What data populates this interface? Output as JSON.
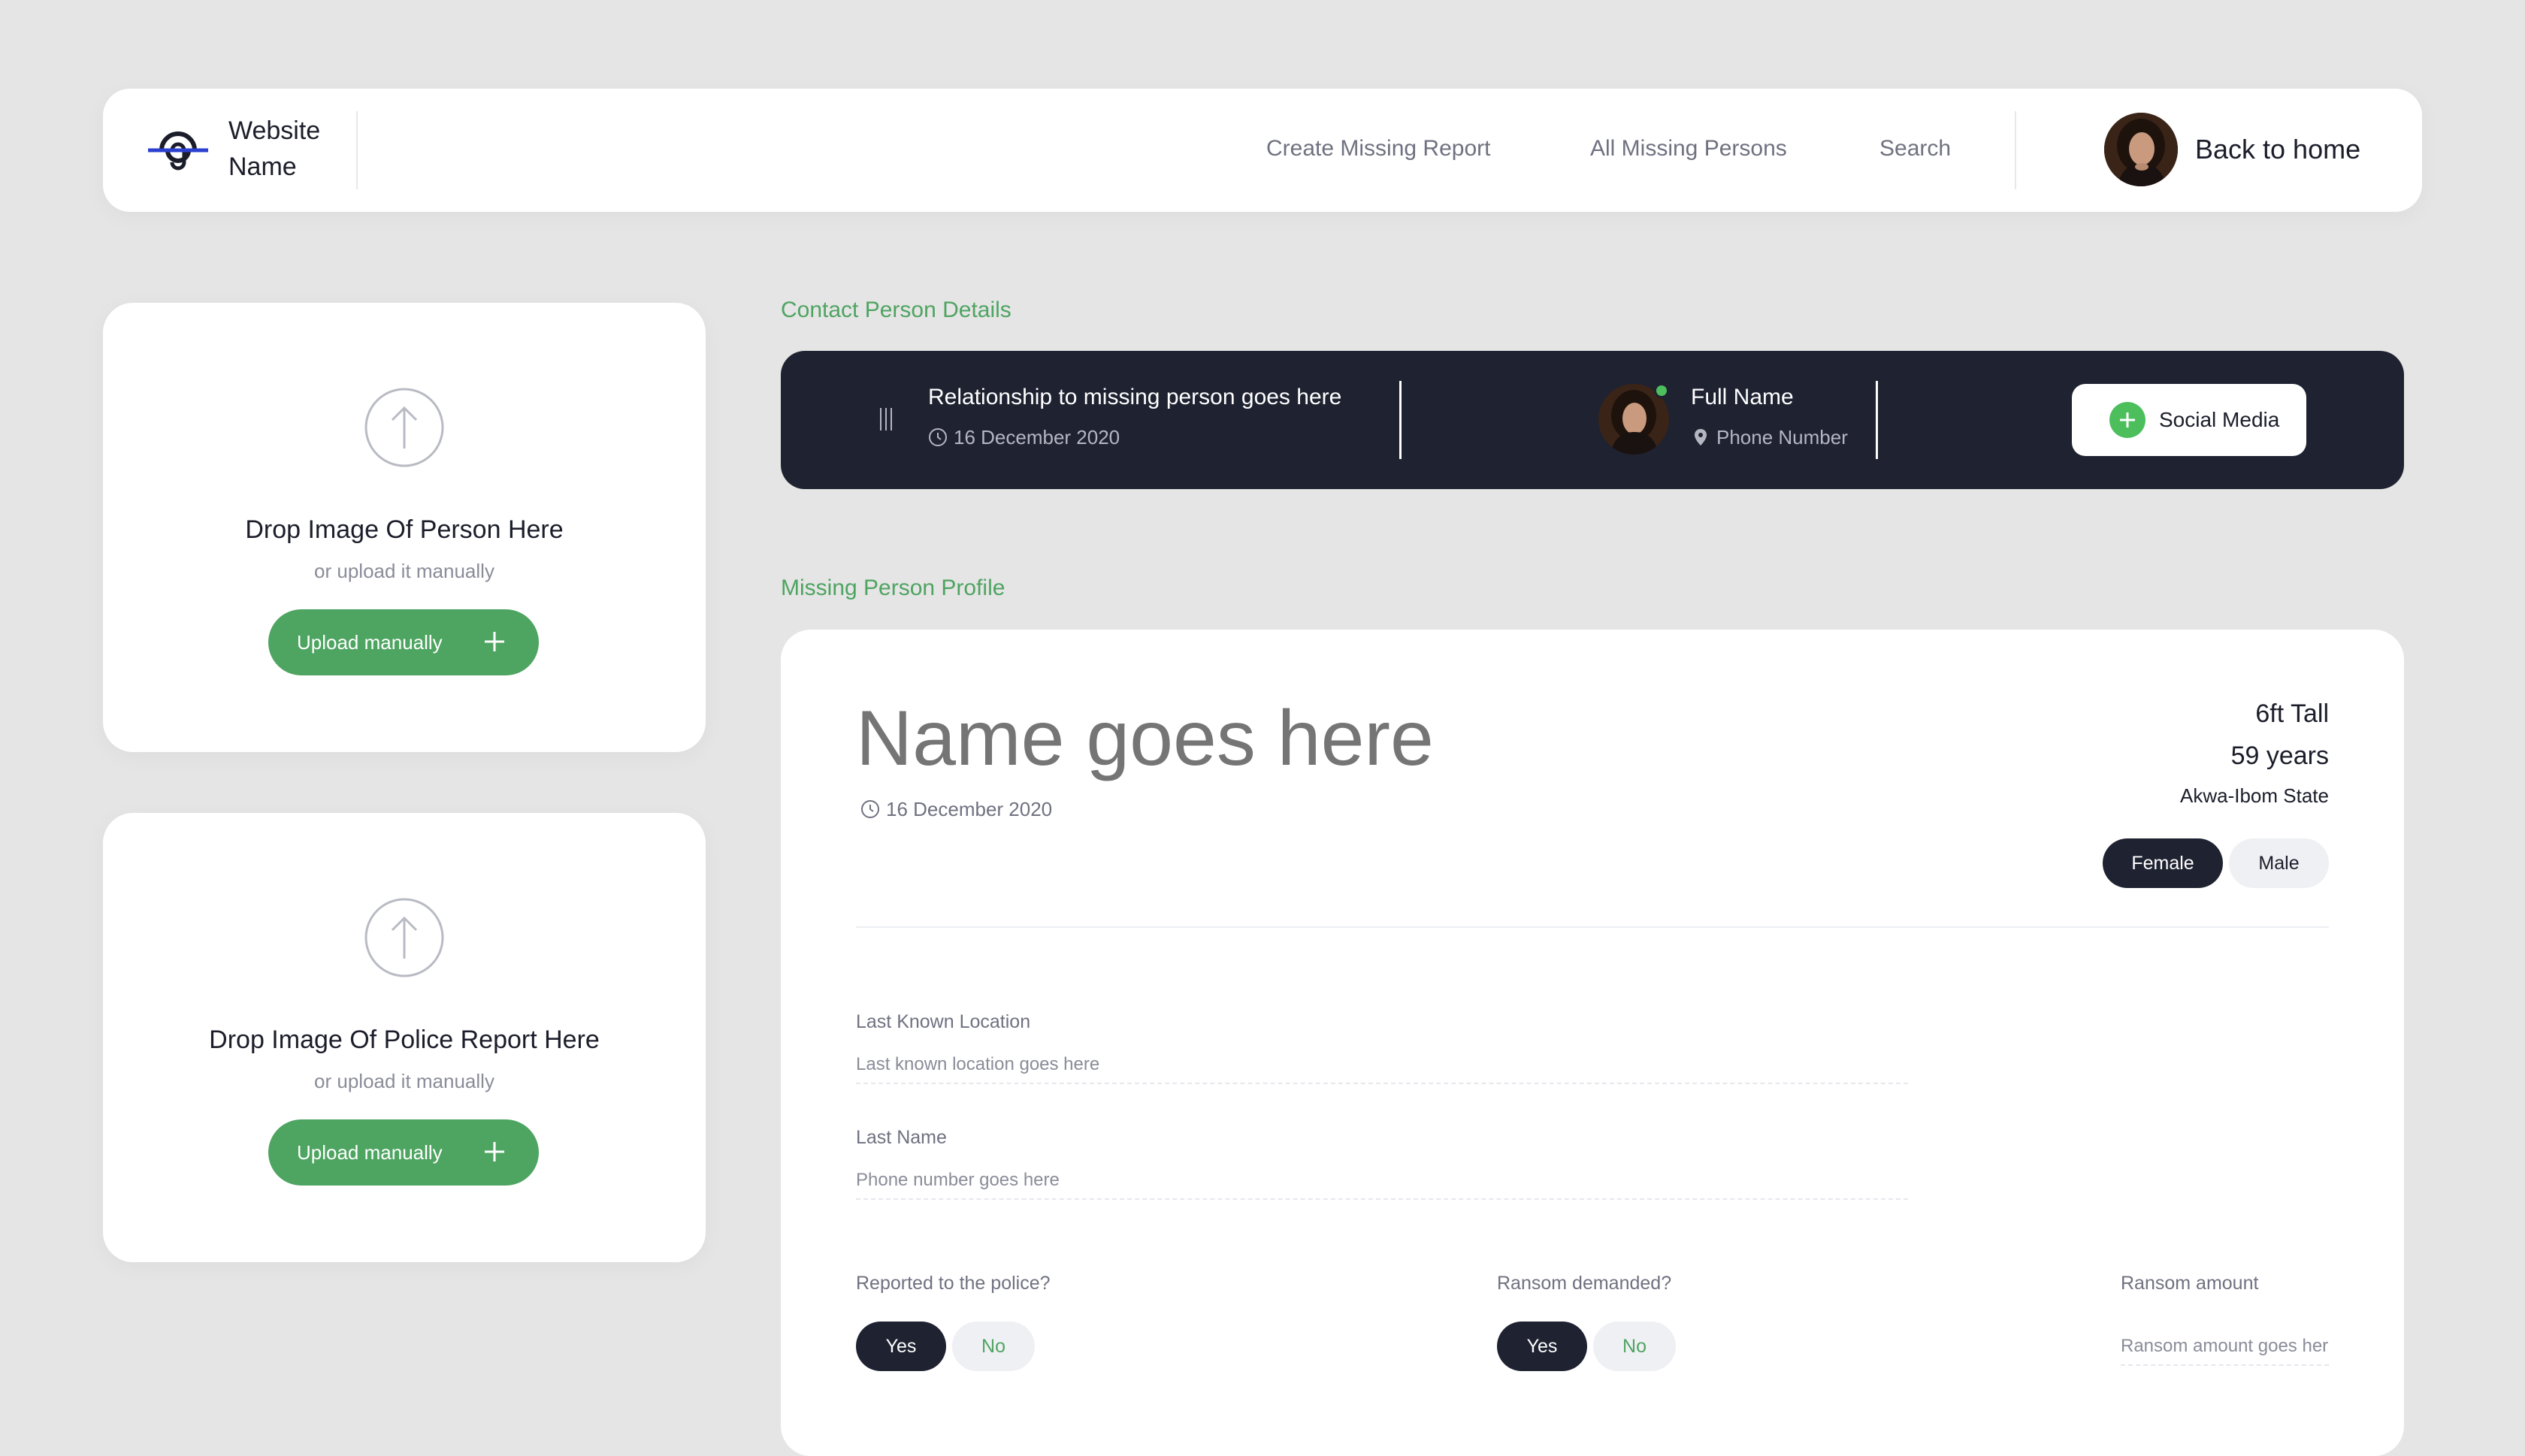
{
  "header": {
    "brand_line1": "Website",
    "brand_line2": "Name",
    "nav": [
      "Create Missing Report",
      "All Missing Persons",
      "Search"
    ],
    "back_home": "Back to home"
  },
  "uploads": [
    {
      "title": "Drop Image Of Person Here",
      "subtitle": "or upload it manually",
      "button": "Upload manually"
    },
    {
      "title": "Drop Image Of Police Report Here",
      "subtitle": "or upload it manually",
      "button": "Upload manually"
    }
  ],
  "contact": {
    "section_label": "Contact Person Details",
    "relationship": "Relationship to missing person goes here",
    "date": "16 December 2020",
    "full_name": "Full Name",
    "phone": "Phone Number",
    "social_button": "Social Media"
  },
  "profile": {
    "section_label": "Missing Person Profile",
    "name_placeholder": "Name goes here",
    "date": "16 December 2020",
    "height": "6ft Tall",
    "age": "59 years",
    "state": "Akwa-Ibom State",
    "gender_options": [
      "Female",
      "Male"
    ],
    "gender_selected": "Female",
    "last_location_label": "Last Known Location",
    "last_location_placeholder": "Last known location goes here",
    "last_name_label": "Last Name",
    "last_name_placeholder": "Phone number goes here",
    "police_label": "Reported to the police?",
    "police_options": [
      "Yes",
      "No"
    ],
    "police_selected": "Yes",
    "ransom_label": "Ransom demanded?",
    "ransom_options": [
      "Yes",
      "No"
    ],
    "ransom_selected": "Yes",
    "ransom_amount_label": "Ransom amount",
    "ransom_amount_placeholder": "Ransom amount goes her"
  },
  "colors": {
    "accent_green": "#4ea461",
    "dark_navy": "#1f2231",
    "online_dot": "#4cbf5c",
    "logo_blue": "#2b3fd0"
  },
  "icons": {
    "logo": "brand-logo-icon",
    "upload": "arrow-up-circle-icon",
    "plus": "plus-icon",
    "clock": "clock-icon",
    "location": "location-pin-icon",
    "drag": "drag-handle-icon"
  }
}
